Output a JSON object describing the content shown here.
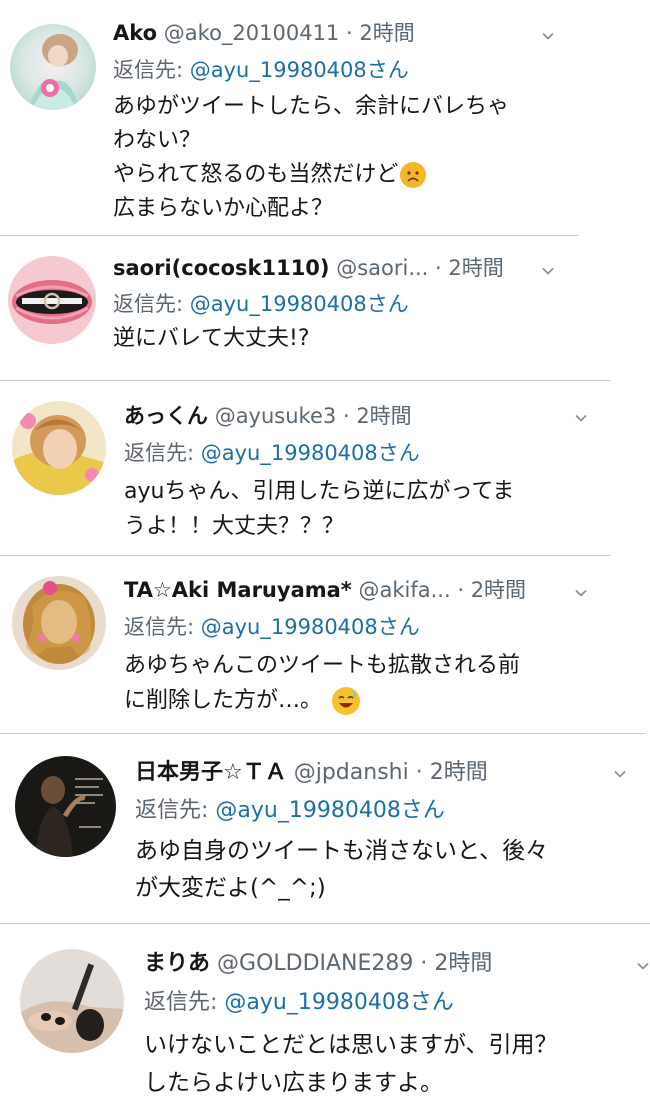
{
  "reply_prefix": "返信先:",
  "tweets": [
    {
      "name": "Ako",
      "handle": "@ako_20100411",
      "separator": "·",
      "time": "2時間",
      "mention": "@ayu_19980408さん",
      "lines": [
        "あゆがツイートしたら、余計にバレちゃ",
        "わない？",
        "やられて怒るのも当然だけど",
        "広まらないか心配よ？"
      ]
    },
    {
      "name": "saori(cocosk￼1110)",
      "handle": "@saori...",
      "separator": "·",
      "time": "2時間",
      "mention": "@ayu_19980408さん",
      "lines": [
        "逆にバレて大丈夫!?"
      ]
    },
    {
      "name": "あっくん",
      "handle": "@ayusuke3",
      "separator": "·",
      "time": "2時間",
      "mention": "@ayu_19980408さん",
      "lines": [
        "ayuちゃん、引用したら逆に広がってま",
        "うよ！！大丈夫？？？"
      ]
    },
    {
      "name": "TA☆Aki Maruyama*",
      "handle": "@akifa...",
      "separator": "·",
      "time": "2時間",
      "mention": "@ayu_19980408さん",
      "lines": [
        "あゆちゃんこのツイートも拡散される前",
        "に削除した方が…。"
      ]
    },
    {
      "name": "日本男子☆ＴＡ",
      "handle": "@jpdanshi",
      "separator": "·",
      "time": "2時間",
      "mention": "@ayu_19980408さん",
      "lines": [
        "あゆ自身のツイートも消さないと、後々",
        "が大変だよ(^_^;)"
      ]
    },
    {
      "name": "まりあ",
      "handle": "@GOLDDIANE289",
      "separator": "·",
      "time": "2時間",
      "mention": "@ayu_19980408さん",
      "lines": [
        "いけないことだとは思いますが、引用？",
        "したらよけい広まりますよ。"
      ]
    }
  ]
}
